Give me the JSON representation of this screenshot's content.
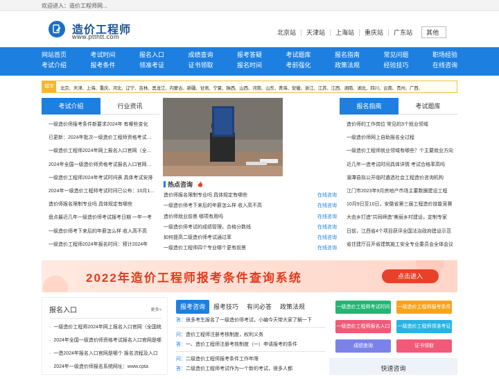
{
  "topbar": {
    "welcome": "欢迎进入：造价工程师网..."
  },
  "logo": {
    "title": "造价工程师",
    "url": "www.ptthtt.com"
  },
  "sites": [
    "北京站",
    "天津站",
    "上海站",
    "重庆站",
    "广东站"
  ],
  "site_other": "其他",
  "nav": {
    "row1": [
      "网站首页",
      "考试时间",
      "报名入口",
      "成绩查询",
      "报考答疑",
      "考试题库",
      "报名指南",
      "常见问题",
      "职场经验"
    ],
    "row2": [
      "考试介绍",
      "报考条件",
      "领准考证",
      "证书领取",
      "报名时间",
      "考前强化",
      "政策法规",
      "经验技巧",
      "在线咨询"
    ]
  },
  "cities": {
    "label": "城市",
    "list": "北京、天津、上海、重庆、河北、辽宁、吉林、黑龙江、内蒙古、新疆、甘肃、宁夏、陕西、山西、河南、山东、青海、安徽、浙江、江苏、江西、湖南、湖北、四川、云南、贵州、广西、"
  },
  "left_tabs": [
    "考试介绍",
    "行业资讯"
  ],
  "left_list": [
    "一级造价师报考条件新要求2024年 有哪些变化",
    "已更新：2024年批次一级造价工程师资格考试报名",
    "一级造价工程师2024年网上报名入口官网（全国统一）",
    "2024年全国一级造价师资格考试报名入口官网是哪个",
    "一级造价工程师2024年考试时间表 具体考试安排",
    "2024年一级造价工程师考试时间已公布：10月19日",
    "造价师报名限制专业吗 具体规定有哪些",
    "盘点最近几年一级造价师考试报考日期 一年一考",
    "一级造价师考下来后的年薪怎么样 收入高不高",
    "一级造价工程师2024年报名时间：预计2024年"
  ],
  "hot": {
    "title": "热点咨询",
    "rows": [
      {
        "q": "造价师报名限制专业吗 具体规定有哪些",
        "a": "在线咨询"
      },
      {
        "q": "一级造价师考下来后的年薪怎么样 收入高不高",
        "a": "在线咨询"
      },
      {
        "q": "造价师就业前景 哪项有用吗",
        "a": "在线咨询"
      },
      {
        "q": "一级造价师考试的成绩管理，合格分数线",
        "a": "在线咨询"
      },
      {
        "q": "如何提高二级造价师考试通过率",
        "a": "在线咨询"
      },
      {
        "q": "一级造价工程师四个专业哪个更有前景",
        "a": "在线咨询"
      }
    ]
  },
  "right_tabs": [
    "报名指南",
    "考试题库"
  ],
  "right_list": [
    "造价师的工作岗位 常见的3个就业领域",
    "一级造价师网上自助报名全过程",
    "一级造价工程师就业领域有哪些？个主要就业方向",
    "近几年一造考试时间具体详情 考试合格率高吗",
    "湄潭县拟公开临时遴选社会工程造价咨询机构",
    "江门市2023年9月房地产市场主要数据建设工程",
    "10月9日至10日，安徽省第三届工程造价技能竞赛",
    "大由乡打造\"共同缔造\"美丽乡村建设，定制专家",
    "日前，江西省4个项目获评全国法治政府建设示范",
    "省住建厅召开省建筑施工安全专业委员会全体会议"
  ],
  "banner": {
    "text": "2022年造价工程师报考条件查询系统",
    "button": "点击进入"
  },
  "left_panel": {
    "title": "报名入口",
    "more": "更多>",
    "list": [
      "一级造价工程师2024年网上报名入口官网（全国统一）",
      "2024年全国一级造价师资格考试报名入口官网是哪个",
      "一造2024年报名入口官网是哪个 报名流程及入口",
      "2024年一级造价师报名系统网址：www.cpta"
    ]
  },
  "mid_tabs": [
    "报考咨询",
    "报考技巧",
    "有问必答",
    "政策法规"
  ],
  "mid_qa": [
    {
      "k": "答：",
      "t": "很多考生报名了一级造价师考试，小编今天带大家了解一下"
    },
    {
      "k": "问：",
      "t": "造价工程师注册考核制度，权利义务"
    },
    {
      "k": "答：",
      "t": "一、造价工程师注册考核制度（一）申请报考的条件"
    },
    {
      "k": "问：",
      "t": "二级造价工程师报考条件工作年限"
    },
    {
      "k": "答：",
      "t": "二级造价工程师考试作为一个新的考试，很多人都"
    }
  ],
  "quick_buttons": [
    {
      "label": "一级造价工程师考试时间",
      "color": "#22b573"
    },
    {
      "label": "一级造价工程师报考条件",
      "color": "#f7a41d"
    },
    {
      "label": "一级造价工程师报名入口",
      "color": "#f05a78"
    },
    {
      "label": "一级造价工程师领准考证",
      "color": "#27b4e4"
    },
    {
      "label": "成绩查询",
      "color": "#7b83eb"
    },
    {
      "label": "证书领取",
      "color": "#f05a78"
    }
  ],
  "quick_title": "快速咨询",
  "colors": {
    "accent": "#1d7fe0",
    "banner_red": "#e03a1c"
  }
}
